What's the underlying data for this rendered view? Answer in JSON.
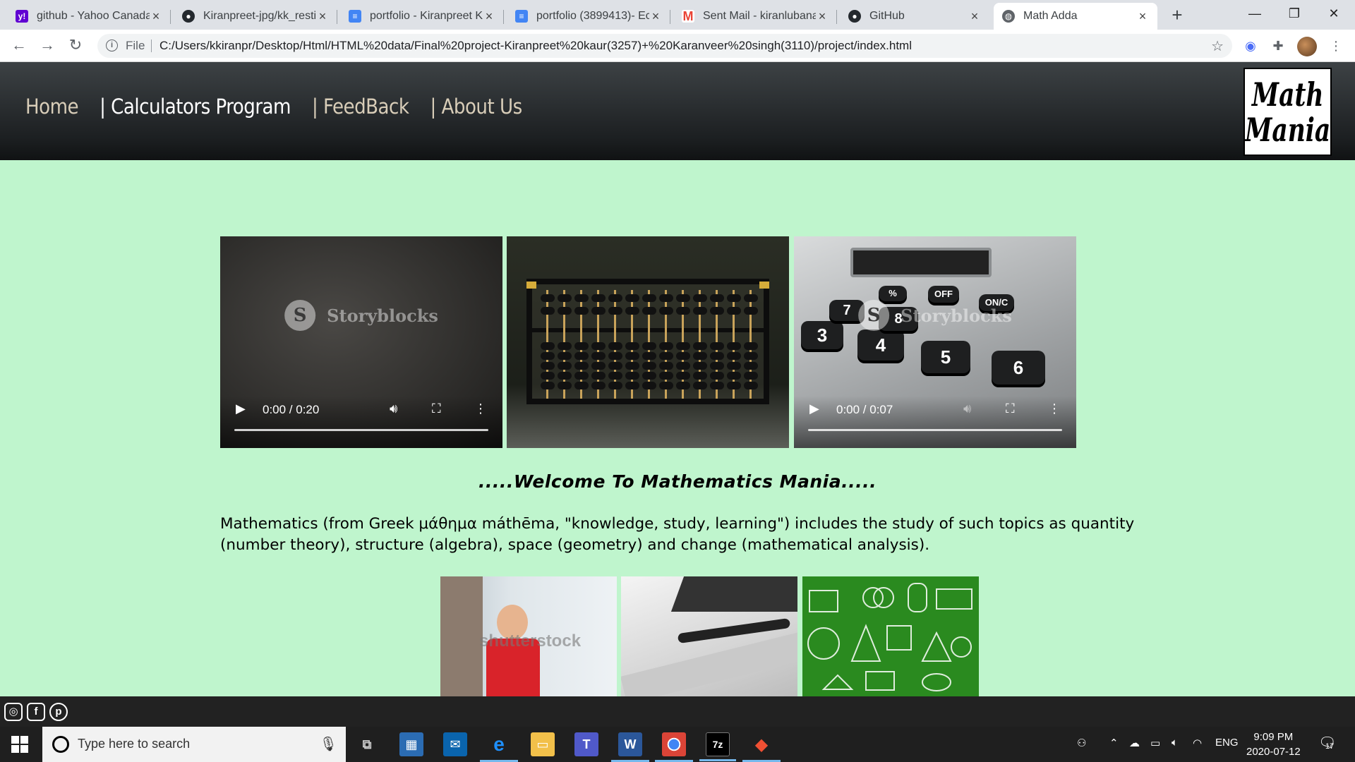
{
  "browser": {
    "tabs": [
      {
        "label": "github - Yahoo Canada",
        "favicon": "yahoo-icon",
        "color": "#6001d2"
      },
      {
        "label": "Kiranpreet-jpg/kk_resti",
        "favicon": "github-icon",
        "color": "#24292e"
      },
      {
        "label": "portfolio - Kiranpreet K",
        "favicon": "docs-icon",
        "color": "#4285f4"
      },
      {
        "label": "portfolio (3899413)- Ec",
        "favicon": "docs-icon",
        "color": "#4285f4"
      },
      {
        "label": "Sent Mail - kiranlubana",
        "favicon": "gmail-icon",
        "color": "#ea4335"
      },
      {
        "label": "GitHub",
        "favicon": "github-icon",
        "color": "#24292e"
      },
      {
        "label": "Math Adda",
        "favicon": "globe-icon",
        "color": "#5f6368"
      }
    ],
    "new_tab": "+",
    "address": {
      "scheme_label": "File",
      "url": "C:/Users/kkiranpr/Desktop/Html/HTML%20data/Final%20project-Kiranpreet%20kaur(3257)+%20Karanveer%20singh(3110)/project/index.html"
    }
  },
  "site": {
    "nav": [
      {
        "label": "Home"
      },
      {
        "label": "| Calculators Program"
      },
      {
        "label": "| FeedBack"
      },
      {
        "label": "| About Us"
      }
    ],
    "logo": {
      "line1": "Math",
      "line2": "Mania"
    },
    "videos": [
      {
        "time": "0:00 / 0:20",
        "watermark": "Storyblocks"
      },
      {
        "time": "",
        "watermark": ""
      },
      {
        "time": "0:00 / 0:07",
        "watermark": "Storyblocks"
      }
    ],
    "calc_keys": [
      "%",
      "OFF",
      "ON/C",
      "3",
      "4",
      "5",
      "6",
      "7",
      "8"
    ],
    "welcome": ".....Welcome To Mathematics Mania.....",
    "intro": "Mathematics (from Greek μάθημα máthēma, \"knowledge, study, learning\") includes the study of such topics as quantity (number theory), structure (algebra), space (geometry) and change (mathematical analysis).",
    "thumb_watermark": "shutterstock",
    "social": [
      "instagram-icon",
      "facebook-icon",
      "pinterest-icon"
    ]
  },
  "taskbar": {
    "search_placeholder": "Type here to search",
    "language": "ENG",
    "time": "9:09 PM",
    "date": "2020-07-12",
    "notifications": "17"
  }
}
